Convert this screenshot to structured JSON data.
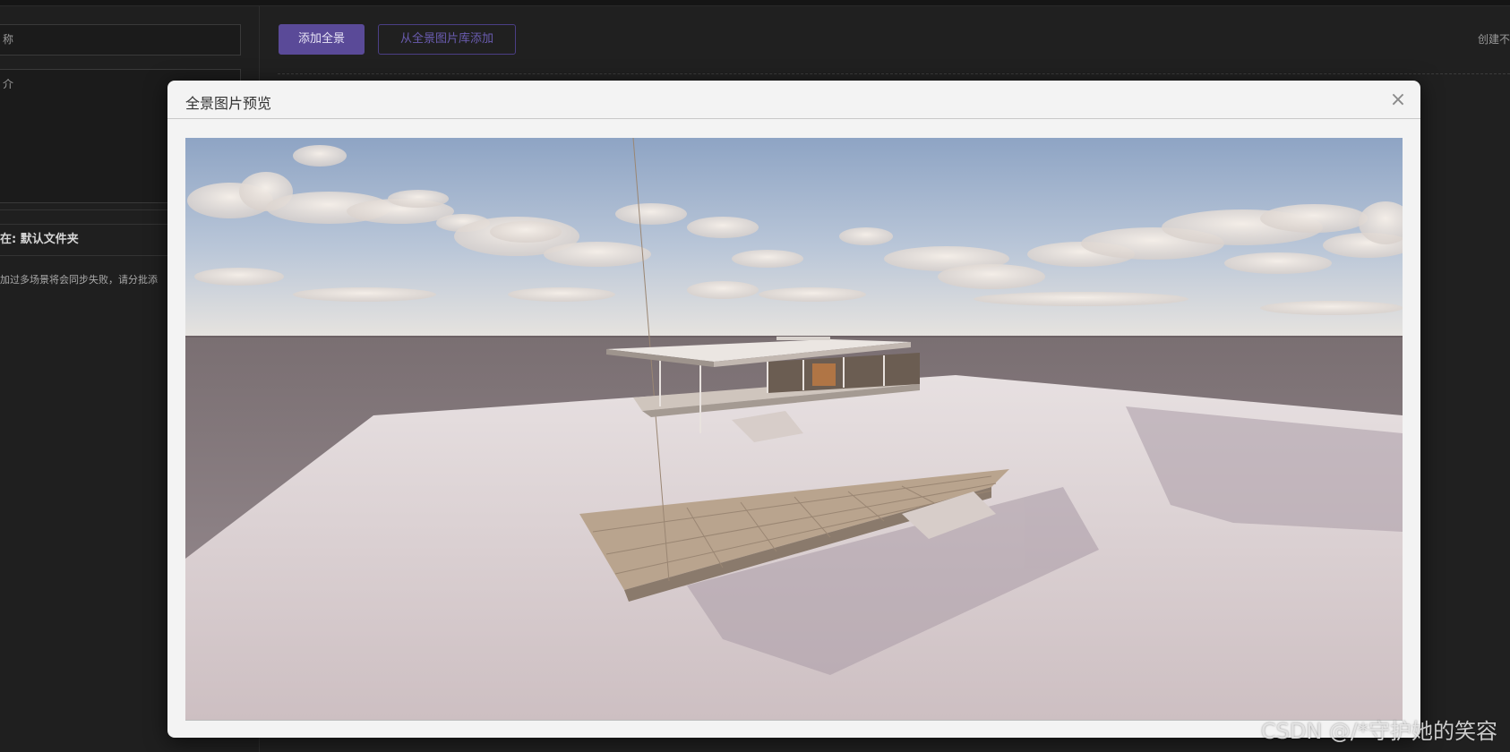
{
  "left_panel": {
    "name_placeholder": "称",
    "intro_placeholder": "介",
    "folder_label": "在: 默认文件夹",
    "hint": "加过多场景将会同步失败，请分批添"
  },
  "toolbar": {
    "add_panorama": "添加全景",
    "add_from_library": "从全景图片库添加",
    "create_text": "创建不"
  },
  "modal": {
    "title": "全景图片预览",
    "close_symbol": "×"
  },
  "watermark": "CSDN @/*守护她的笑容"
}
